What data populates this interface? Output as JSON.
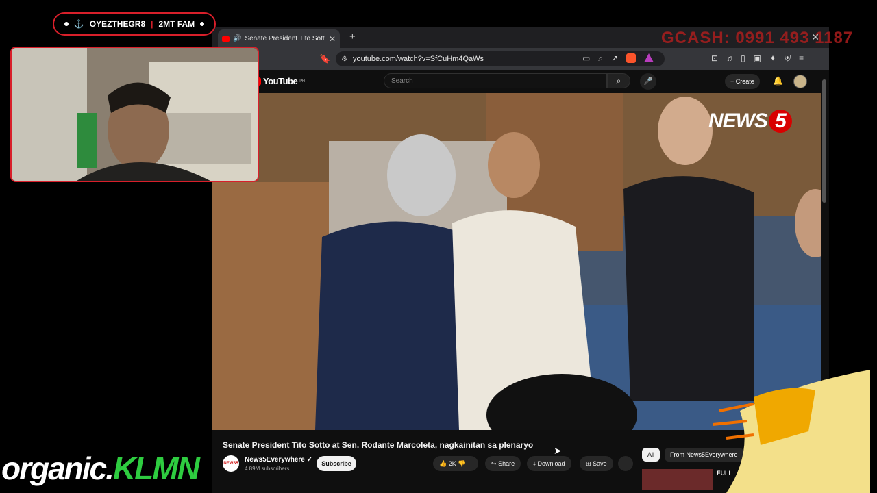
{
  "overlay": {
    "streamer_name": "OYEZTHEGR8",
    "separator": "|",
    "fam_label": "2MT FAM",
    "gcash_text": "GCASH: 0991 493 1187",
    "organic_prefix": "organic.",
    "organic_brand": "KLMN"
  },
  "browser": {
    "tab_title": "Senate President Tito Sotto at Sen. Rodante Marcoleta, nagkainitan sa plenaryo",
    "url": "youtube.com/watch?v=SfCuHm4QaWs"
  },
  "youtube": {
    "logo_text": "YouTube",
    "region": "PH",
    "search_placeholder": "Search",
    "create_label": "Create",
    "watermark": "NEWS",
    "watermark_num": "5",
    "video_title": "Senate President Tito Sotto at Sen. Rodante Marcoleta, nagkainitan sa plenaryo",
    "channel_name": "News5Everywhere",
    "channel_avatar_text": "NEWS5",
    "subscribers": "4.89M subscribers",
    "subscribe_label": "Subscribe",
    "likes": "2K",
    "share_label": "Share",
    "download_label": "Download",
    "save_label": "Save",
    "chip_all": "All",
    "chip_from": "From News5Everywhere",
    "rec_title": "FULL"
  },
  "colors": {
    "accent_red": "#d81f2a",
    "youtube_red": "#ff0000",
    "brand_green": "#2ecc40"
  }
}
